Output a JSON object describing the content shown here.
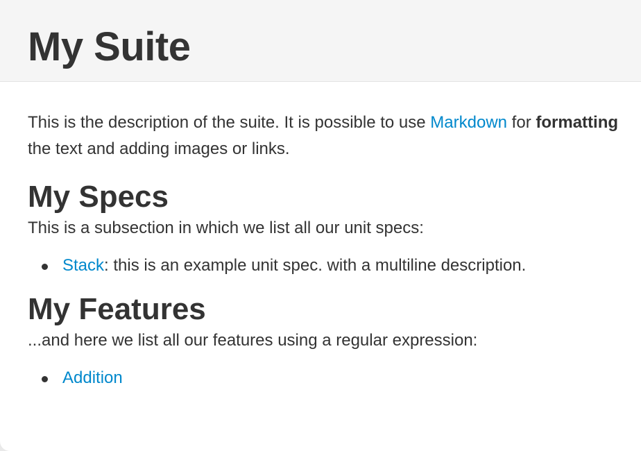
{
  "suite": {
    "title": "My Suite"
  },
  "description": {
    "part1": "This is the description of the suite. It is possible to use ",
    "link_text": "Markdown",
    "part2": " for ",
    "bold_text": "formatting",
    "part3": " the text and adding images or links."
  },
  "sections": [
    {
      "title": "My Specs",
      "intro": "This is a subsection in which we list all our unit specs:",
      "items": [
        {
          "link_text": "Stack",
          "suffix": ": this is an example unit spec. with a multiline description."
        }
      ]
    },
    {
      "title": "My Features",
      "intro": "...and here we list all our features using a regular expression:",
      "items": [
        {
          "link_text": "Addition",
          "suffix": ""
        }
      ]
    }
  ],
  "colors": {
    "link": "#0088cc",
    "text": "#333333",
    "header_bg": "#f5f5f5"
  }
}
